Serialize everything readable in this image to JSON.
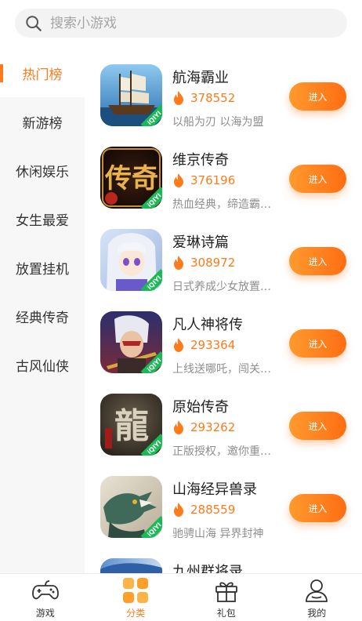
{
  "search": {
    "placeholder": "搜索小游戏"
  },
  "sidebar": {
    "items": [
      {
        "label": "热门榜",
        "active": true
      },
      {
        "label": "新游榜"
      },
      {
        "label": "休闲娱乐"
      },
      {
        "label": "女生最爱"
      },
      {
        "label": "放置挂机"
      },
      {
        "label": "经典传奇"
      },
      {
        "label": "古风仙侠"
      }
    ]
  },
  "games": [
    {
      "name": "航海霸业",
      "hot": "378552",
      "desc": "以船为刃 以海为盟",
      "button": "进入",
      "badge": "iQIYI"
    },
    {
      "name": "维京传奇",
      "hot": "376196",
      "desc": "热血经典，缔造霸…",
      "button": "进入",
      "badge": "iQIYI",
      "icon_text": "传奇"
    },
    {
      "name": "爱琳诗篇",
      "hot": "308972",
      "desc": "日式养成少女放置…",
      "button": "进入",
      "badge": "iQIYI"
    },
    {
      "name": "凡人神将传",
      "hot": "293364",
      "desc": "上线送哪吒，闯关…",
      "button": "进入",
      "badge": "iQIYI"
    },
    {
      "name": "原始传奇",
      "hot": "293262",
      "desc": "正版授权，邀你重…",
      "button": "进入",
      "badge": "iQIYI",
      "icon_text": "龍"
    },
    {
      "name": "山海经异兽录",
      "hot": "288559",
      "desc": "驰骋山海 异界封神",
      "button": "进入",
      "badge": "iQIYI"
    },
    {
      "name": "九州群将录"
    }
  ],
  "tabbar": {
    "items": [
      {
        "label": "游戏",
        "icon": "gamepad-icon"
      },
      {
        "label": "分类",
        "icon": "category-icon",
        "active": true
      },
      {
        "label": "礼包",
        "icon": "gift-icon"
      },
      {
        "label": "我的",
        "icon": "profile-icon"
      }
    ]
  },
  "colors": {
    "accent": "#ff7a1a",
    "badge": "#19b955"
  }
}
